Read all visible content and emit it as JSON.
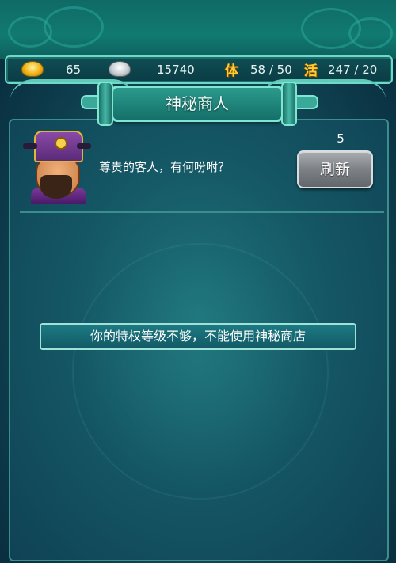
{
  "resources": {
    "gold": {
      "icon": "gold-ingot-icon",
      "value": "65"
    },
    "silver": {
      "icon": "silver-ingot-icon",
      "value": "15740"
    },
    "stamina": {
      "icon_char": "体",
      "value": "58 / 50"
    },
    "vigor": {
      "icon_char": "活",
      "value": "247 / 20"
    }
  },
  "title": "神秘商人",
  "merchant": {
    "greeting": "尊贵的客人，有何吩咐？",
    "refresh_count": "5",
    "refresh_label": "刷新"
  },
  "notice": "你的特权等级不够，不能使用神秘商店",
  "colors": {
    "accent": "#7fe6d2",
    "gold": "#f0b316",
    "char_icon": "#ffcc33"
  }
}
